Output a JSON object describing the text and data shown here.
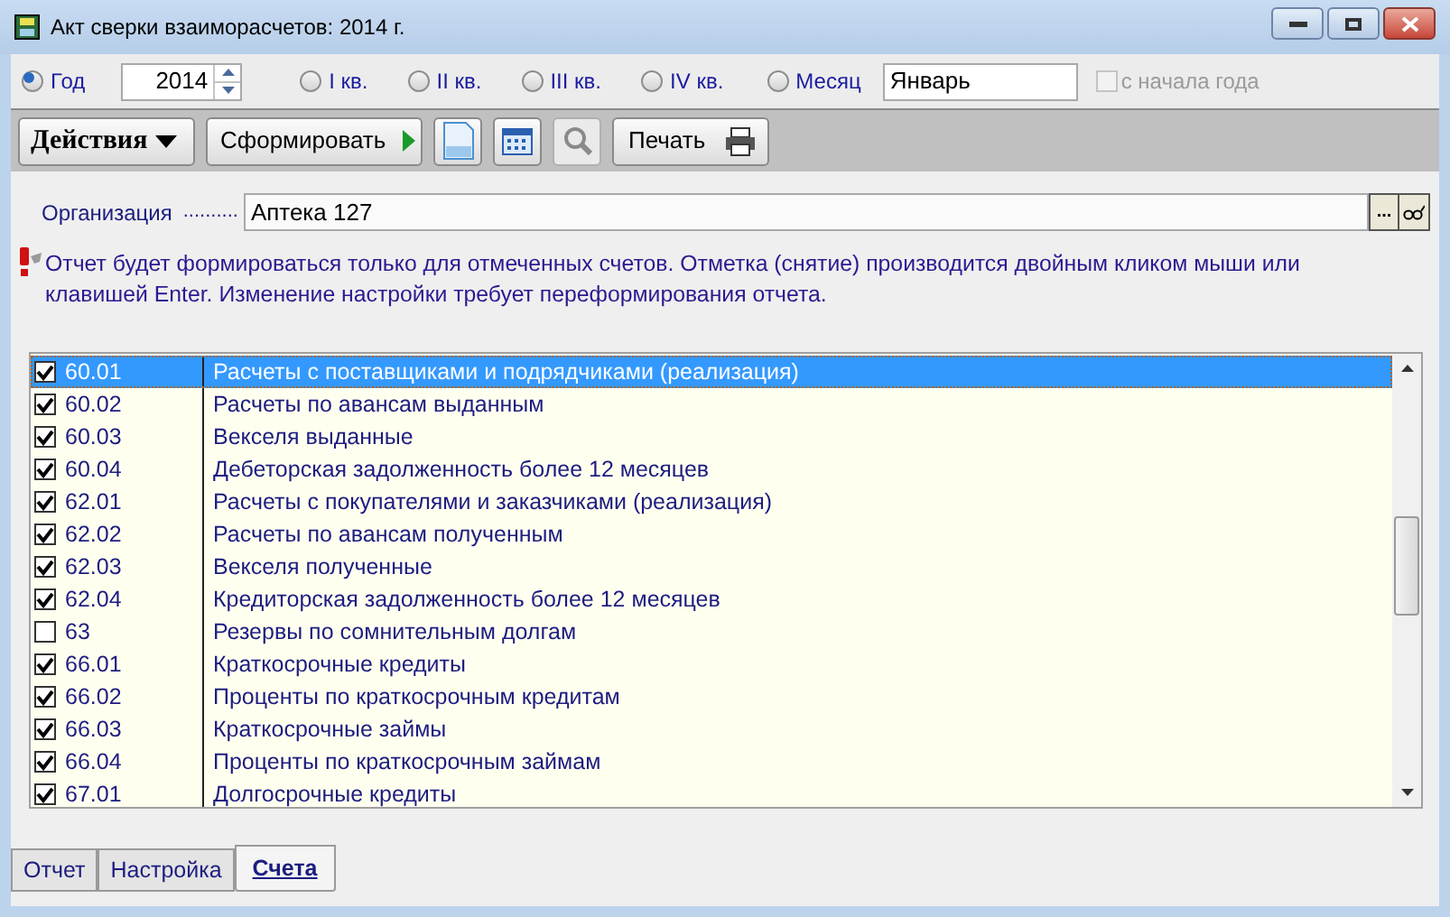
{
  "window": {
    "title": "Акт сверки взаиморасчетов: 2014 г."
  },
  "period": {
    "year": "2014",
    "options": [
      {
        "label": "Год",
        "selected": true
      },
      {
        "label": "I кв.",
        "selected": false
      },
      {
        "label": "II кв.",
        "selected": false
      },
      {
        "label": "III кв.",
        "selected": false
      },
      {
        "label": "IV кв.",
        "selected": false
      },
      {
        "label": "Месяц",
        "selected": false
      }
    ],
    "month": "Январь",
    "from_year_start": {
      "label": "с начала года",
      "checked": false,
      "disabled": true
    }
  },
  "toolbar": {
    "actions": "Действия",
    "generate": "Сформировать",
    "print": "Печать"
  },
  "organization": {
    "label": "Организация",
    "dots": "..........",
    "value": "Аптека 127",
    "browse": "..."
  },
  "note": "Отчет будет формироваться только для отмеченных счетов. Отметка (снятие)  производится двойным кликом мыши или клавишей Enter. Изменение настройки требует переформирования отчета.",
  "accounts": [
    {
      "code": "60.01",
      "name": "Расчеты с поставщиками и подрядчиками (реализация)",
      "checked": true,
      "selected": true
    },
    {
      "code": "60.02",
      "name": "Расчеты по авансам выданным",
      "checked": true,
      "selected": false
    },
    {
      "code": "60.03",
      "name": "Векселя выданные",
      "checked": true,
      "selected": false
    },
    {
      "code": "60.04",
      "name": "Дебеторская задолженность более 12 месяцев",
      "checked": true,
      "selected": false
    },
    {
      "code": "62.01",
      "name": "Расчеты с покупателями и заказчиками (реализация)",
      "checked": true,
      "selected": false
    },
    {
      "code": "62.02",
      "name": "Расчеты по авансам полученным",
      "checked": true,
      "selected": false
    },
    {
      "code": "62.03",
      "name": "Векселя полученные",
      "checked": true,
      "selected": false
    },
    {
      "code": "62.04",
      "name": "Кредиторская задолженность более 12 месяцев",
      "checked": true,
      "selected": false
    },
    {
      "code": "63",
      "name": "Резервы по сомнительным долгам",
      "checked": false,
      "selected": false
    },
    {
      "code": "66.01",
      "name": "Краткосрочные кредиты",
      "checked": true,
      "selected": false
    },
    {
      "code": "66.02",
      "name": "Проценты по краткосрочным кредитам",
      "checked": true,
      "selected": false
    },
    {
      "code": "66.03",
      "name": "Краткосрочные займы",
      "checked": true,
      "selected": false
    },
    {
      "code": "66.04",
      "name": "Проценты по краткосрочным займам",
      "checked": true,
      "selected": false
    },
    {
      "code": "67.01",
      "name": "Долгосрочные кредиты",
      "checked": true,
      "selected": false
    }
  ],
  "tabs": [
    {
      "label": "Отчет",
      "selected": false
    },
    {
      "label": "Настройка",
      "selected": false
    },
    {
      "label": "Счета",
      "selected": true
    }
  ]
}
